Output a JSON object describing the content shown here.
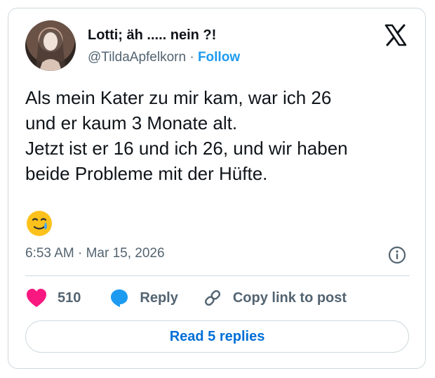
{
  "author": {
    "display_name": "Lotti; äh ..... nein ?!",
    "handle": "@TildaApfelkorn",
    "separator": "·",
    "follow_label": "Follow"
  },
  "post": {
    "lines": [
      "Als mein Kater zu mir kam, war ich 26",
      "und er kaum 3 Monate alt.",
      "Jetzt ist er 16 und ich 26, und wir haben",
      "beide Probleme mit der Hüfte."
    ],
    "emoji": "smiling-face-with-tear"
  },
  "meta": {
    "time": "6:53 AM",
    "separator": "·",
    "date": "Mar 15, 2026"
  },
  "actions": {
    "like_count": "510",
    "reply_label": "Reply",
    "copy_label": "Copy link to post"
  },
  "read_replies_label": "Read 5 replies",
  "colors": {
    "like": "#f91880",
    "reply": "#1d9bf0",
    "link": "#006fd6",
    "border": "#cfd9de",
    "muted": "#536471"
  },
  "icons": [
    "x-logo-icon",
    "info-icon",
    "heart-icon",
    "speech-bubble-icon",
    "link-icon"
  ]
}
